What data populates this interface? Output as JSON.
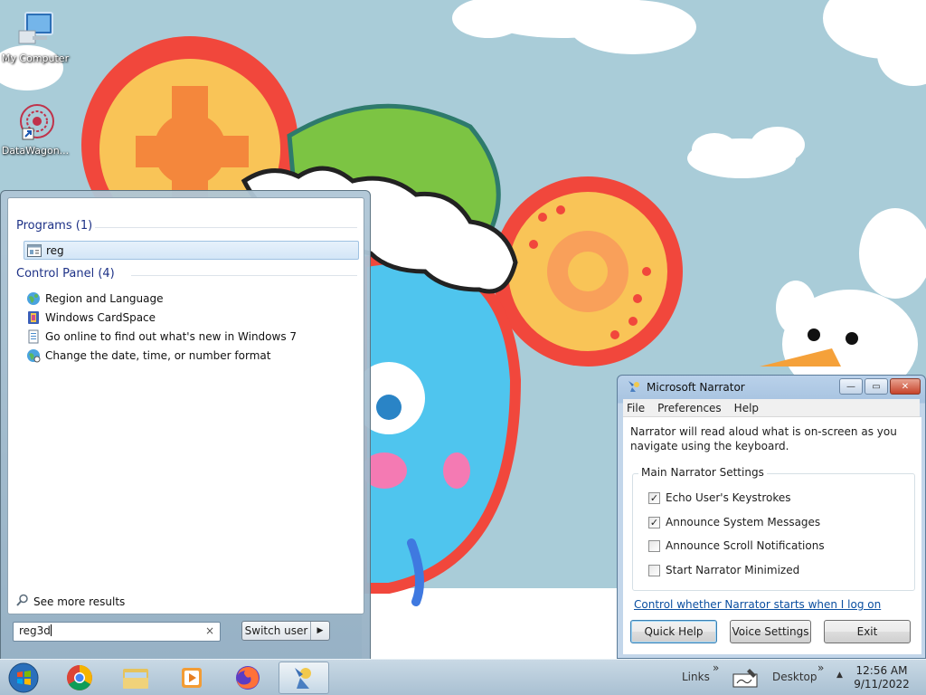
{
  "desktop": {
    "icons": [
      {
        "label": "My Computer"
      },
      {
        "label": "DataWagon..."
      }
    ]
  },
  "start_menu": {
    "programs_header": "Programs (1)",
    "programs": [
      {
        "label": "reg"
      }
    ],
    "control_panel_header": "Control Panel (4)",
    "control_panel": [
      {
        "label": "Region and Language"
      },
      {
        "label": "Windows CardSpace"
      },
      {
        "label": "Go online to find out what's new in Windows 7"
      },
      {
        "label": "Change the date, time, or number format"
      }
    ],
    "see_more": "See more results",
    "search_value": "reg3d",
    "clear_glyph": "×",
    "switch_user": "Switch user",
    "switch_arrow": "▶"
  },
  "narrator": {
    "title": "Microsoft Narrator",
    "menu": [
      "File",
      "Preferences",
      "Help"
    ],
    "description": "Narrator will read aloud what is on-screen as you navigate using the keyboard.",
    "group_title": "Main Narrator Settings",
    "options": [
      {
        "label": "Echo User's Keystrokes",
        "checked": true
      },
      {
        "label": "Announce System Messages",
        "checked": true
      },
      {
        "label": "Announce Scroll Notifications",
        "checked": false
      },
      {
        "label": "Start Narrator Minimized",
        "checked": false
      }
    ],
    "link": "Control whether Narrator starts when I log on",
    "buttons": {
      "quick_help": "Quick Help",
      "voice_settings": "Voice Settings",
      "exit": "Exit"
    },
    "window_buttons": {
      "minimize": "—",
      "maximize": "▭",
      "close": "✕"
    }
  },
  "taskbar": {
    "pinned": [
      "start-orb",
      "chrome",
      "explorer",
      "media-player",
      "firefox",
      "narrator"
    ],
    "links": "Links",
    "desktop": "Desktop",
    "chevron": "»",
    "tray_arrow": "▲",
    "time": "12:56 AM",
    "date": "9/11/2022"
  },
  "colors": {
    "link": "#0b4fa0",
    "group_header": "#1e3287",
    "wallpaper_sky": "#a9ccd8"
  }
}
